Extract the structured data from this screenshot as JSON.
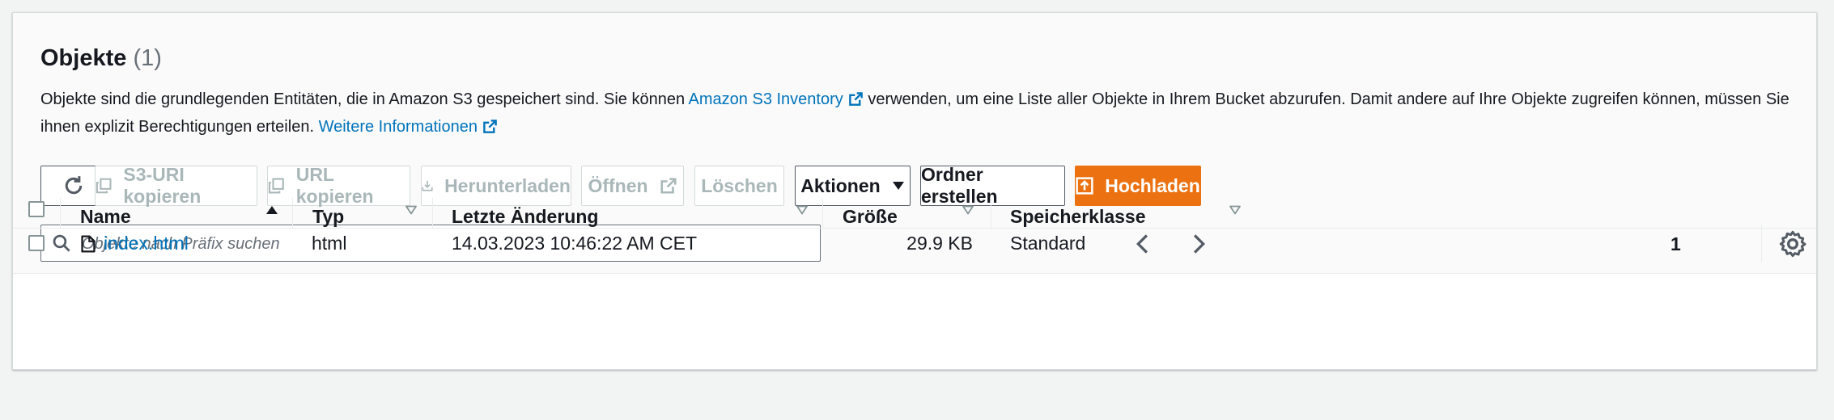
{
  "section": {
    "title": "Objekte",
    "count": "(1)",
    "description_part1": "Objekte sind die grundlegenden Entitäten, die in Amazon S3 gespeichert sind. Sie können",
    "inventory_link": "Amazon S3 Inventory",
    "description_part2": "verwenden, um eine Liste aller Objekte in Ihrem Bucket abzurufen. Damit andere auf Ihre Objekte zugreifen können, müssen Sie ihnen explizit Berechtigungen erteilen.",
    "more_info_link": "Weitere Informationen"
  },
  "toolbar": {
    "copy_s3_uri": "S3-URI kopieren",
    "copy_url": "URL kopieren",
    "download": "Herunterladen",
    "open": "Öffnen",
    "delete": "Löschen",
    "actions": "Aktionen",
    "create_folder": "Ordner erstellen",
    "upload": "Hochladen"
  },
  "search": {
    "placeholder": "Objekte nach Präfix suchen",
    "value": ""
  },
  "pagination": {
    "current_page": "1"
  },
  "table": {
    "columns": [
      "Name",
      "Typ",
      "Letzte Änderung",
      "Größe",
      "Speicherklasse"
    ],
    "rows": [
      {
        "name": "index.html",
        "type": "html",
        "last_modified": "14.03.2023 10:46:22 AM CET",
        "size": "29.9 KB",
        "storage_class": "Standard"
      }
    ]
  },
  "colors": {
    "accent": "#ec7211",
    "link": "#0073bb",
    "text": "#16191f",
    "disabled": "#aab7b8"
  },
  "icons": [
    "refresh-icon",
    "copy-icon",
    "download-icon",
    "external-link-icon",
    "caret-down-icon",
    "upload-icon",
    "search-icon",
    "chevron-left-icon",
    "chevron-right-icon",
    "gear-icon",
    "sort-ascending-icon",
    "sort-icon",
    "file-icon"
  ]
}
